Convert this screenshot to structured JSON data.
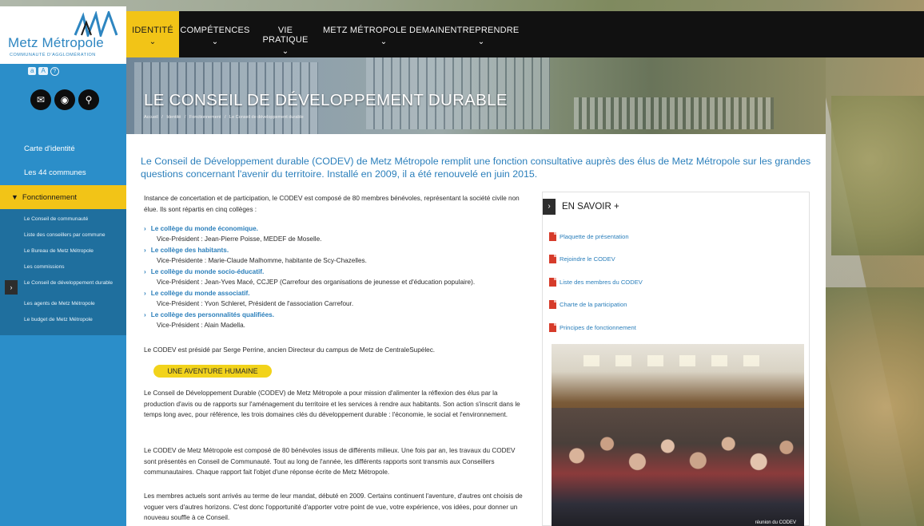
{
  "brand": {
    "name": "Metz Métropole",
    "tagline": "COMMUNAUTÉ D'AGGLOMÉRATION",
    "colors": {
      "blue": "#2b8ec9",
      "yellow": "#f2c417",
      "dark": "#111111",
      "link": "#2b7fbb"
    }
  },
  "nav": {
    "items": [
      {
        "label": "IDENTITÉ",
        "icon": "chevron-down-icon"
      },
      {
        "label": "COMPÉTENCES",
        "icon": "chevron-down-icon"
      },
      {
        "label": "VIE PRATIQUE",
        "icon": "chevron-down-icon"
      },
      {
        "label": "METZ MÉTROPOLE DEMAIN",
        "icon": "chevron-down-icon"
      },
      {
        "label": "ENTREPRENDRE",
        "icon": "chevron-down-icon"
      }
    ]
  },
  "tools": {
    "size_small": "a",
    "size_large": "A",
    "help": "?"
  },
  "social": [
    "mail-icon",
    "camera-icon",
    "map-pin-icon"
  ],
  "sidebar": {
    "items": [
      {
        "label": "Carte d'identité"
      },
      {
        "label": "Les 44 communes"
      },
      {
        "label": "Fonctionnement"
      }
    ],
    "submenu": [
      {
        "label": "Le Conseil de communauté"
      },
      {
        "label": "Liste des conseillers par commune"
      },
      {
        "label": "Le Bureau de Metz Métropole"
      },
      {
        "label": "Les commissions"
      },
      {
        "label": "Le Conseil de développement durable"
      },
      {
        "label": "Les agents de Metz Métropole"
      },
      {
        "label": "Le budget de Metz Métropole"
      }
    ]
  },
  "hero": {
    "title": "LE CONSEIL DE DÉVELOPPEMENT DURABLE",
    "breadcrumb": [
      "Accueil",
      "/",
      "Identité",
      "/",
      "Fonctionnement",
      "/",
      "Le Conseil de développement durable"
    ]
  },
  "content": {
    "lead": "Le Conseil de Développement durable (CODEV) de Metz Métropole remplit une fonction consultative auprès des élus de Metz Métropole sur les grandes questions concernant l'avenir du territoire. Installé en 2009, il a été renouvelé en juin 2015.",
    "intro": "Instance de concertation et de participation, le CODEV est composé de 80 membres bénévoles, représentant la société civile non élue. Ils sont répartis en cinq collèges :",
    "colleges": [
      {
        "name": "Le collège du monde économique.",
        "vp": "Vice-Président : Jean-Pierre Poisse, MEDEF de Moselle."
      },
      {
        "name": "Le collège des habitants.",
        "vp": "Vice-Présidente : Marie-Claude Malhomme, habitante de Scy-Chazelles."
      },
      {
        "name": "Le collège du monde socio-éducatif.",
        "vp": "Vice-Président : Jean-Yves Macé, CCJEP (Carrefour des organisations de jeunesse et d'éducation populaire)."
      },
      {
        "name": "Le collège du monde associatif.",
        "vp": "Vice-Président : Yvon Schleret, Président de l'association Carrefour."
      },
      {
        "name": "Le collège des personnalités qualifiées.",
        "vp": "Vice-Président : Alain Madella."
      }
    ],
    "president": "Le CODEV est présidé par Serge Perrine, ancien Directeur du campus de Metz de CentraleSupélec.",
    "section_title": "UNE AVENTURE HUMAINE",
    "paragraphs": [
      "Le Conseil de Développement Durable (CODEV) de Metz Métropole a    pour mission d'alimenter la réflexion des élus par la production d'avis ou de rapports sur l'aménagement du territoire et les services à rendre aux habitants. Son action s'inscrit dans le temps long avec, pour référence, les trois domaines clés du développement durable : l'économie, le social et l'environnement.",
      "Le CODEV de Metz Métropole est composé de 80 bénévoles issus de différents milieux. Une fois par an, les travaux du CODEV sont présentés en Conseil de Communauté. Tout au long de l'année, les différents rapports sont transmis aux Conseillers communautaires. Chaque rapport fait l'objet d'une réponse écrite de Metz Métropole.",
      "Les membres actuels sont arrivés au terme de leur mandat, débuté en 2009. Certains continuent l'aventure, d'autres ont choisis de voguer vers d'autres horizons. C'est donc l'opportunité d'apporter votre point de vue, votre expérience, vos idées, pour donner un nouveau souffle à ce Conseil."
    ]
  },
  "savoir": {
    "title": "EN SAVOIR +",
    "docs": [
      "Plaquette de présentation",
      "Rejoindre le CODEV",
      "Liste des membres du CODEV",
      "Charte de la participation",
      "Principes de fonctionnement"
    ],
    "photo_caption": "réunion du CODEV"
  }
}
